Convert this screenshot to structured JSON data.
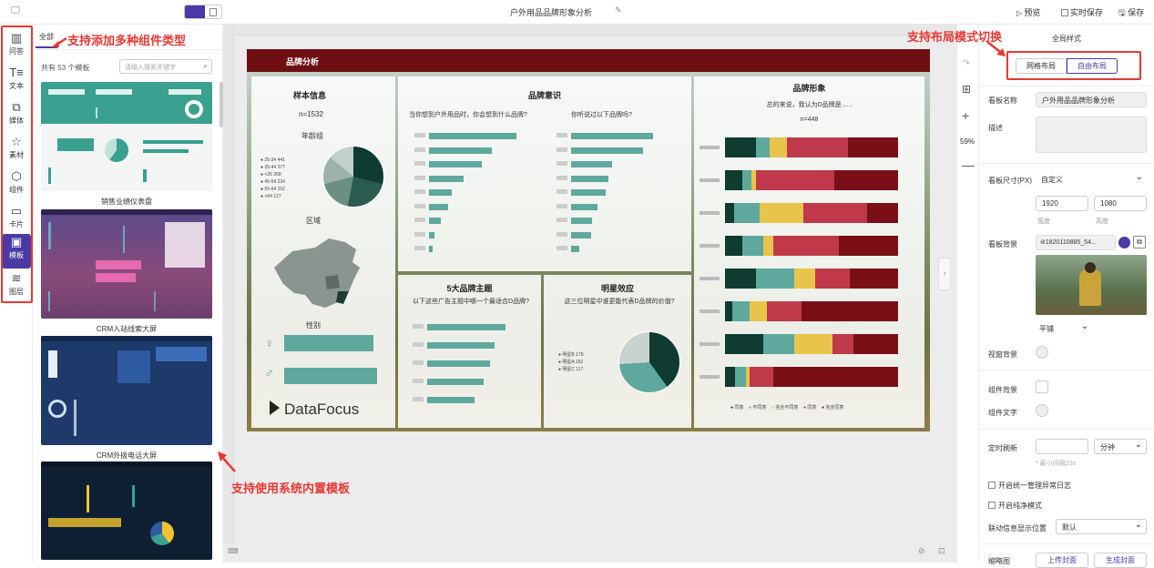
{
  "app": {
    "title": "户外用品品牌形象分析",
    "preview": "预览",
    "realtime_save": "实时保存",
    "save": "保存"
  },
  "rail": [
    {
      "label": "问答",
      "icon": "bar-chart-icon"
    },
    {
      "label": "文本",
      "icon": "text-icon"
    },
    {
      "label": "媒体",
      "icon": "image-icon"
    },
    {
      "label": "素材",
      "icon": "star-icon"
    },
    {
      "label": "组件",
      "icon": "puzzle-icon"
    },
    {
      "label": "卡片",
      "icon": "card-icon"
    },
    {
      "label": "模板",
      "icon": "template-icon"
    },
    {
      "label": "图层",
      "icon": "layers-icon"
    }
  ],
  "templates": {
    "tab_all": "全部",
    "count_text": "共有 53 个模板",
    "search_placeholder": "请输入搜索关键字",
    "items": [
      {
        "name": "销售业绩仪表盘"
      },
      {
        "name": "CRM入站线索大屏"
      },
      {
        "name": "CRM外拨电话大屏"
      }
    ]
  },
  "annotations": {
    "components": "支持添加多种组件类型",
    "templates": "支持使用系统内置模板",
    "layout": "支持布局模式切换"
  },
  "board": {
    "header": "品牌分析",
    "sample": {
      "title": "样本信息",
      "n": "n=1532",
      "age_label": "年龄组",
      "region_label": "区域",
      "gender_label": "性别"
    },
    "awareness": {
      "title": "品牌意识",
      "q1": "当你想到户外用品时，你会想到什么品牌?",
      "q2": "你听说过以下品牌吗?"
    },
    "image": {
      "title": "品牌形象",
      "subtitle": "总的来说，我认为D品牌是......",
      "n_label": "n=",
      "n_value": "448"
    },
    "themes": {
      "title": "5大品牌主题",
      "question": "以下这些广告主题中哪一个最适合D品牌?"
    },
    "star": {
      "title": "明星效应",
      "question": "这三位明星中谁更能代表D品牌的价值?"
    },
    "logo": "DataFocus"
  },
  "tools": {
    "zoom": "59%"
  },
  "props": {
    "header": "全局样式",
    "layout_grid": "网格布局",
    "layout_free": "自由布局",
    "board_name_label": "看板名称",
    "board_name_value": "户外用品品牌形象分析",
    "desc_label": "描述",
    "size_label": "看板尺寸(PX)",
    "size_value": "自定义",
    "width": "1920",
    "height": "1080",
    "width_label": "宽度",
    "height_label": "高度",
    "bg_label": "看板背景",
    "bg_value": "1820110885_54...",
    "tile_value": "平铺",
    "window_bg_label": "视窗背景",
    "comp_bg_label": "组件背景",
    "comp_text_label": "组件文字",
    "refresh_label": "定时刷新",
    "refresh_unit": "分钟",
    "refresh_hint": "* 最小间隔20s",
    "unified_log": "开启统一管理异常日志",
    "pure_mode": "开启纯净模式",
    "link_pos_label": "联动信息显示位置",
    "link_pos_value": "默认",
    "thumb_label": "缩略图",
    "upload_cover": "上传封面",
    "gen_cover": "生成封面"
  }
}
